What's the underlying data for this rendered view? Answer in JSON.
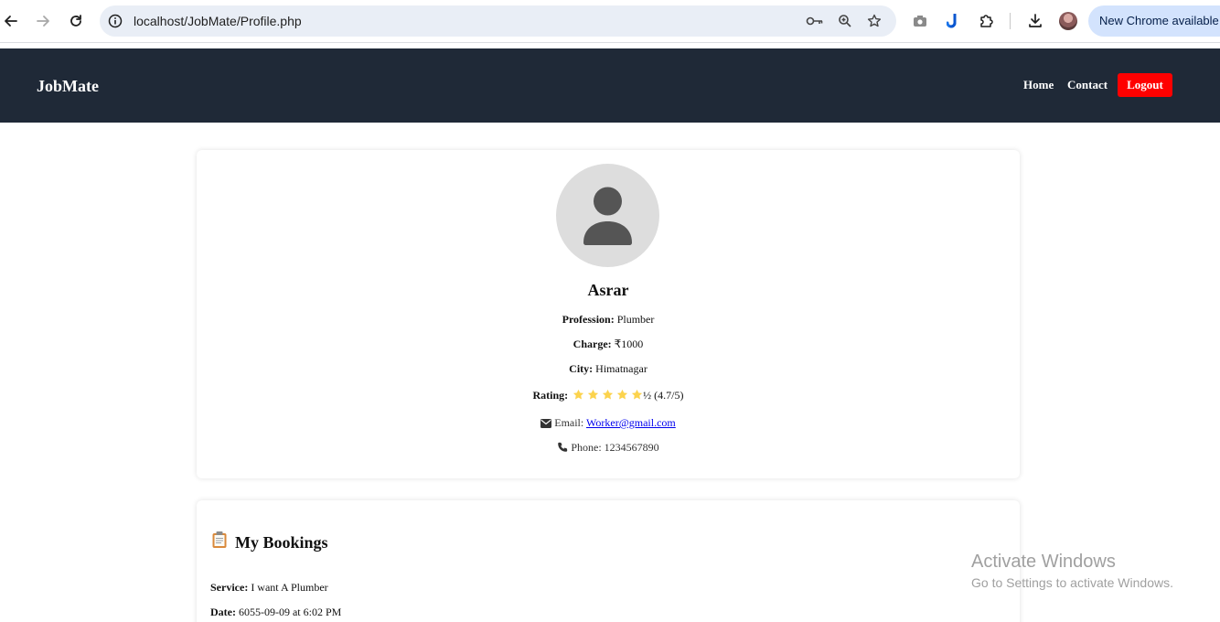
{
  "browser": {
    "url": "localhost/JobMate/Profile.php",
    "update_label": "New Chrome available",
    "icons": [
      "back-arrow-icon",
      "forward-arrow-icon",
      "reload-icon",
      "site-info-icon",
      "password-key-icon",
      "zoom-icon",
      "bookmark-star-icon",
      "screenshot-camera-icon",
      "extension-app-icon",
      "extensions-puzzle-icon",
      "download-icon",
      "profile-avatar"
    ]
  },
  "header": {
    "brand": "JobMate",
    "nav": [
      "Home",
      "Contact"
    ],
    "logout_label": "Logout",
    "colors": {
      "background": "#1f2937",
      "logout": "#ff0000"
    }
  },
  "profile": {
    "name": "Asrar",
    "profession_label": "Profession:",
    "profession": "Plumber",
    "charge_label": "Charge:",
    "charge": "₹1000",
    "city_label": "City:",
    "city": "Himatnagar",
    "rating_label": "Rating:",
    "rating_stars": 5,
    "rating_suffix": "½ (4.7/5)",
    "email_label": "Email:",
    "email": "Worker@gmail.com",
    "phone_label": "Phone:",
    "phone": "1234567890",
    "star_color": "#fcd34d"
  },
  "bookings": {
    "title": "My Bookings",
    "service_label": "Service:",
    "service": "I want A Plumber",
    "date_label": "Date:",
    "date": "6055-09-09 at 6:02 PM"
  },
  "watermark": {
    "line1": "Activate Windows",
    "line2": "Go to Settings to activate Windows."
  }
}
